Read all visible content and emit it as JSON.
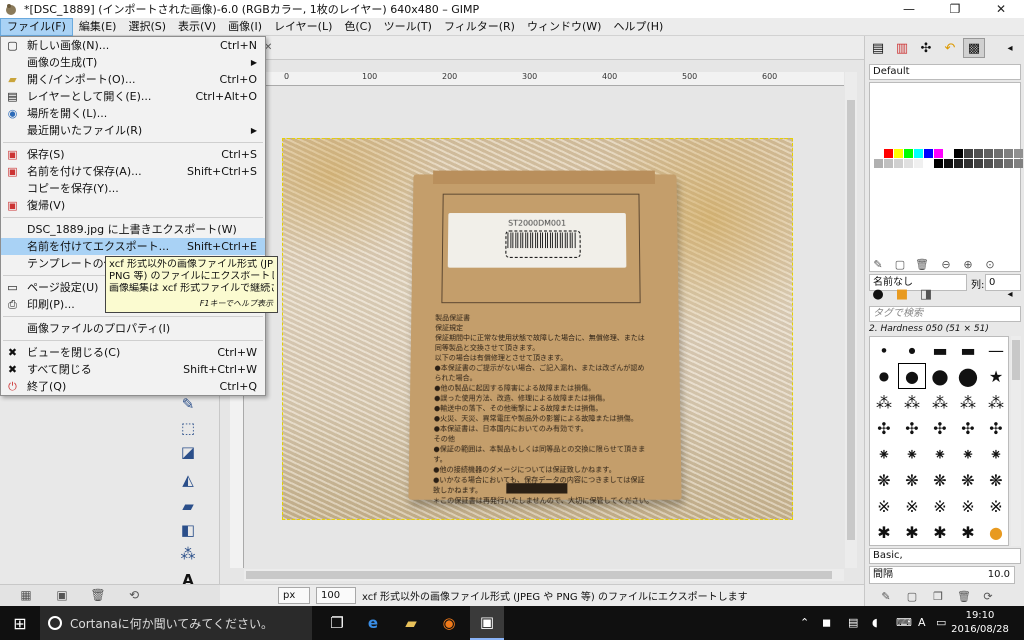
{
  "window": {
    "title": "*[DSC_1889] (インポートされた画像)-6.0 (RGBカラー, 1枚のレイヤー) 640x480 – GIMP",
    "minimize": "—",
    "maximize": "❐",
    "close": "✕"
  },
  "menubar": [
    "ファイル(F)",
    "編集(E)",
    "選択(S)",
    "表示(V)",
    "画像(I)",
    "レイヤー(L)",
    "色(C)",
    "ツール(T)",
    "フィルター(R)",
    "ウィンドウ(W)",
    "ヘルプ(H)"
  ],
  "file_menu": {
    "items": [
      {
        "label": "新しい画像(N)...",
        "accel": "Ctrl+N"
      },
      {
        "label": "画像の生成(T)",
        "accel": ""
      },
      {
        "label": "開く/インポート(O)...",
        "accel": "Ctrl+O"
      },
      {
        "label": "レイヤーとして開く(E)...",
        "accel": "Ctrl+Alt+O"
      },
      {
        "label": "場所を開く(L)...",
        "accel": ""
      },
      {
        "label": "最近開いたファイル(R)",
        "accel": ""
      },
      {
        "label": "保存(S)",
        "accel": "Ctrl+S"
      },
      {
        "label": "名前を付けて保存(A)...",
        "accel": "Shift+Ctrl+S"
      },
      {
        "label": "コピーを保存(Y)...",
        "accel": ""
      },
      {
        "label": "復帰(V)",
        "accel": ""
      },
      {
        "label": "DSC_1889.jpg に上書きエクスポート(W)",
        "accel": ""
      },
      {
        "label": "名前を付けてエクスポート...",
        "accel": "Shift+Ctrl+E"
      },
      {
        "label": "テンプレートの作成...",
        "accel": ""
      },
      {
        "label": "ページ設定(U)",
        "accel": ""
      },
      {
        "label": "印刷(P)...",
        "accel": ""
      },
      {
        "label": "画像ファイルのプロパティ(I)",
        "accel": ""
      },
      {
        "label": "ビューを閉じる(C)",
        "accel": "Ctrl+W"
      },
      {
        "label": "すべて閉じる",
        "accel": "Shift+Ctrl+W"
      },
      {
        "label": "終了(Q)",
        "accel": "Ctrl+Q"
      }
    ]
  },
  "tooltip": {
    "line1": "xcf 形式以外の画像ファイル形式 (JPEG や",
    "line2": "PNG 等) のファイルにエクスポートします",
    "line3": "画像編集は xcf 形式ファイルで継続されます",
    "help": "F1キーでヘルプ表示"
  },
  "ruler": {
    "h": [
      "0",
      "100",
      "200",
      "300",
      "400",
      "500",
      "600"
    ]
  },
  "image": {
    "label_code": "ST2000DM001",
    "box_text": "製品保証書\n保証規定\n保証期間中に正常な使用状態で故障した場合に、無償修理、または\n同等製品と交換させて頂きます。\n以下の場合は有償修理とさせて頂きます。\n●本保証書のご提示がない場合、ご記入漏れ、または改ざんが認め\nられた場合。\n●他の製品に起因する障害による故障または損傷。\n●誤った使用方法、改造、修理による故障または損傷。\n●輸送中の落下、その他衝撃による故障または損傷。\n●火災、天災、異常電圧や製品外の影響による故障または損傷。\n●本保証書は、日本国内においてのみ有効です。\nその他\n●保証の範囲は、本製品もしくは同等品との交換に限らせて頂きます。\n●他の接続機器のダメージについては保証致しかねます。\n●いかなる場合においても、保存データの内容につきましては保証\n致しかねます。\n＊この保証書は再発行いたしませんので、大切に保管してください。"
  },
  "statusbar": {
    "unit": "px",
    "zoom": "100 %",
    "message": "xcf 形式以外の画像ファイル形式 (JPEG や PNG 等) のファイルにエクスポートします"
  },
  "dock": {
    "palette_name": "Default",
    "color_name": "名前なし",
    "column_label": "列:",
    "column_value": "0",
    "brush_filter_placeholder": "タグで検索",
    "brush_name": "2. Hardness 050 (51 × 51)",
    "brush_set": "Basic,",
    "spacing_label": "間隔",
    "spacing_value": "10.0",
    "swatches": [
      "#ffffff",
      "#ff0000",
      "#ffff00",
      "#00ff00",
      "#00ffff",
      "#0000ff",
      "#ff00ff",
      "#ffffff",
      "#000000",
      "#404040",
      "#505050",
      "#606060",
      "#707070",
      "#808080",
      "#909090",
      "#a0a0a0",
      "#b0b0b0",
      "#c0c0c0",
      "#d0d0d0",
      "#e0e0e0",
      "#f0f0f0",
      "#ffffff",
      "#000000",
      "#101010",
      "#202020",
      "#303030",
      "#404040",
      "#505050",
      "#606060",
      "#707070",
      "#808080",
      "#909090"
    ]
  },
  "taskbar": {
    "search_text": "Cortanaに何か聞いてみてください。",
    "time": "19:10",
    "date": "2016/08/28",
    "ime": "A"
  },
  "colors": {
    "menu_highlight": "#a9d2f5",
    "tooltip_bg": "#fbfbd0",
    "selection_border": "#e6d200"
  }
}
